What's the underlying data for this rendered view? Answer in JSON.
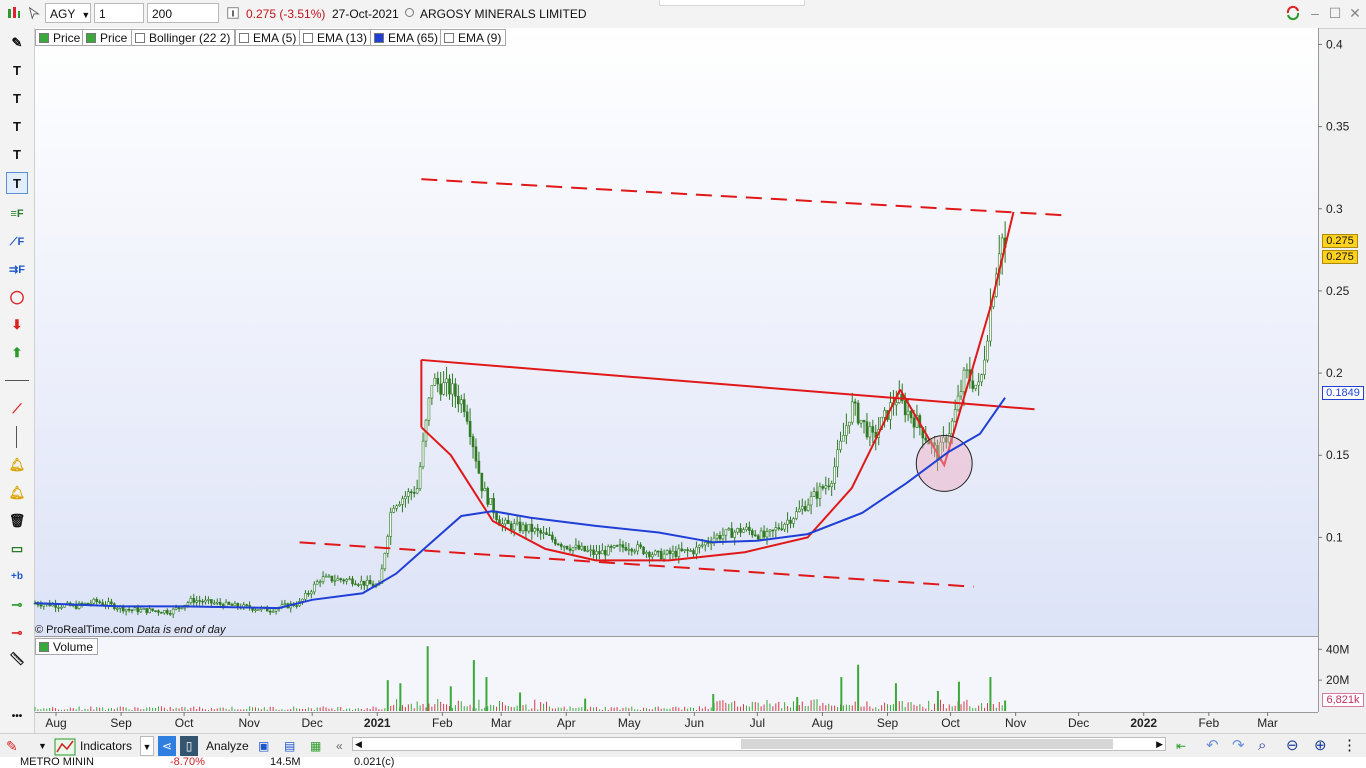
{
  "toolbar": {
    "symbol": "AGY",
    "period": "1 day",
    "units": "200 units",
    "price_change": "0.275 (-3.51%)",
    "date": "27-Oct-2021",
    "instrument": "ARGOSY MINERALS LIMITED"
  },
  "legend": [
    {
      "label": "Price",
      "color": "#3aa83a"
    },
    {
      "label": "Price",
      "color": "#3aa83a"
    },
    {
      "label": "Bollinger (22 2)",
      "color": "#ffffff"
    },
    {
      "label": "EMA (5)",
      "color": "#ffffff"
    },
    {
      "label": "EMA (13)",
      "color": "#ffffff"
    },
    {
      "label": "EMA (65)",
      "color": "#1f3fd6"
    },
    {
      "label": "EMA (9)",
      "color": "#ffffff"
    }
  ],
  "volume_label": "Volume",
  "copyright": "© ProRealTime.com",
  "note": "Data is end of day",
  "price_axis": {
    "ticks": [
      "0.4",
      "0.35",
      "0.3",
      "0.25",
      "0.2",
      "0.15",
      "0.1"
    ]
  },
  "volume_axis": {
    "ticks": [
      "40M",
      "20M"
    ],
    "last_label": "6,821k"
  },
  "price_tags": {
    "close1": "0.275",
    "close2": "0.275",
    "ema65": "0.1849"
  },
  "x_axis": {
    "labels": [
      "Aug",
      "Sep",
      "Oct",
      "Nov",
      "Dec",
      "2021",
      "Feb",
      "Mar",
      "Apr",
      "May",
      "Jun",
      "Jul",
      "Aug",
      "Sep",
      "Oct",
      "Nov",
      "Dec",
      "2022",
      "Feb",
      "Mar"
    ]
  },
  "bottom": {
    "indicators": "Indicators",
    "analyze": "Analyze"
  },
  "ticker": {
    "name": "METRO MININ",
    "change": "-8.70%",
    "volume": "14.5M",
    "price": "0.021(c)"
  },
  "colors": {
    "chart_bg_top": "#ffffff",
    "chart_bg_bottom": "#dde3f7",
    "candle": "#2f7a22",
    "ema": "#1f3fd6",
    "drawing": "#e01818",
    "tag_yellow": "#ffd21f"
  },
  "chart_data": {
    "type": "candlestick",
    "title": "ARGOSY MINERALS LIMITED",
    "ylim": [
      0.04,
      0.41
    ],
    "x_start": "2020-07-22",
    "x_end": "2022-03-25",
    "price_path": [
      [
        "2020-07-22",
        0.06
      ],
      [
        "2020-08-10",
        0.058
      ],
      [
        "2020-08-20",
        0.061
      ],
      [
        "2020-09-05",
        0.056
      ],
      [
        "2020-09-25",
        0.055
      ],
      [
        "2020-10-05",
        0.062
      ],
      [
        "2020-10-20",
        0.059
      ],
      [
        "2020-11-10",
        0.056
      ],
      [
        "2020-11-25",
        0.06
      ],
      [
        "2020-12-05",
        0.075
      ],
      [
        "2020-12-20",
        0.074
      ],
      [
        "2021-01-02",
        0.07
      ],
      [
        "2021-01-08",
        0.12
      ],
      [
        "2021-01-20",
        0.13
      ],
      [
        "2021-01-27",
        0.195
      ],
      [
        "2021-02-05",
        0.19
      ],
      [
        "2021-02-12",
        0.18
      ],
      [
        "2021-02-20",
        0.13
      ],
      [
        "2021-03-01",
        0.108
      ],
      [
        "2021-03-15",
        0.105
      ],
      [
        "2021-04-01",
        0.095
      ],
      [
        "2021-04-15",
        0.09
      ],
      [
        "2021-05-01",
        0.095
      ],
      [
        "2021-05-15",
        0.089
      ],
      [
        "2021-06-01",
        0.092
      ],
      [
        "2021-06-10",
        0.1
      ],
      [
        "2021-06-25",
        0.105
      ],
      [
        "2021-07-05",
        0.1
      ],
      [
        "2021-07-20",
        0.115
      ],
      [
        "2021-08-05",
        0.135
      ],
      [
        "2021-08-15",
        0.18
      ],
      [
        "2021-08-25",
        0.16
      ],
      [
        "2021-09-05",
        0.185
      ],
      [
        "2021-09-15",
        0.17
      ],
      [
        "2021-09-20",
        0.16
      ],
      [
        "2021-09-25",
        0.15
      ],
      [
        "2021-10-02",
        0.17
      ],
      [
        "2021-10-08",
        0.2
      ],
      [
        "2021-10-15",
        0.19
      ],
      [
        "2021-10-20",
        0.24
      ],
      [
        "2021-10-25",
        0.285
      ],
      [
        "2021-10-27",
        0.275
      ]
    ],
    "ema65": [
      [
        "2020-07-22",
        0.06
      ],
      [
        "2020-09-01",
        0.058
      ],
      [
        "2020-10-01",
        0.058
      ],
      [
        "2020-11-15",
        0.057
      ],
      [
        "2020-12-01",
        0.062
      ],
      [
        "2020-12-25",
        0.066
      ],
      [
        "2021-01-10",
        0.078
      ],
      [
        "2021-01-25",
        0.095
      ],
      [
        "2021-02-10",
        0.113
      ],
      [
        "2021-02-25",
        0.116
      ],
      [
        "2021-03-15",
        0.112
      ],
      [
        "2021-04-15",
        0.107
      ],
      [
        "2021-05-15",
        0.103
      ],
      [
        "2021-06-10",
        0.097
      ],
      [
        "2021-07-01",
        0.098
      ],
      [
        "2021-07-25",
        0.102
      ],
      [
        "2021-08-20",
        0.115
      ],
      [
        "2021-09-10",
        0.133
      ],
      [
        "2021-09-30",
        0.152
      ],
      [
        "2021-10-15",
        0.163
      ],
      [
        "2021-10-27",
        0.185
      ]
    ],
    "volume_units": "M",
    "volume_spikes": [
      [
        "2021-01-06",
        20
      ],
      [
        "2021-01-12",
        18
      ],
      [
        "2021-01-25",
        42
      ],
      [
        "2021-02-05",
        16
      ],
      [
        "2021-02-16",
        33
      ],
      [
        "2021-02-22",
        22
      ],
      [
        "2021-03-10",
        12
      ],
      [
        "2021-04-10",
        8
      ],
      [
        "2021-06-10",
        11
      ],
      [
        "2021-07-20",
        9
      ],
      [
        "2021-08-10",
        22
      ],
      [
        "2021-08-18",
        30
      ],
      [
        "2021-09-05",
        18
      ],
      [
        "2021-09-25",
        13
      ],
      [
        "2021-10-05",
        19
      ],
      [
        "2021-10-20",
        22
      ],
      [
        "2021-10-27",
        6.8
      ]
    ],
    "drawings": {
      "upper_channel": {
        "from": [
          "2021-01-22",
          0.318
        ],
        "to": [
          "2021-11-25",
          0.296
        ],
        "style": "dashed"
      },
      "lower_channel": {
        "from": [
          "2020-11-25",
          0.097
        ],
        "to": [
          "2021-10-12",
          0.07
        ],
        "style": "dashed"
      },
      "neckline": {
        "from": [
          "2021-01-22",
          0.208
        ],
        "to": [
          "2021-11-10",
          0.178
        ]
      },
      "cup": [
        [
          "2021-01-22",
          0.167
        ],
        [
          "2021-02-05",
          0.15
        ],
        [
          "2021-02-25",
          0.11
        ],
        [
          "2021-03-22",
          0.093
        ],
        [
          "2021-04-15",
          0.086
        ],
        [
          "2021-05-20",
          0.086
        ],
        [
          "2021-06-25",
          0.091
        ],
        [
          "2021-07-25",
          0.1
        ],
        [
          "2021-08-15",
          0.13
        ],
        [
          "2021-09-07",
          0.19
        ]
      ],
      "handle": [
        [
          "2021-09-07",
          0.19
        ],
        [
          "2021-09-28",
          0.144
        ],
        [
          "2021-10-20",
          0.24
        ],
        [
          "2021-10-31",
          0.298
        ]
      ],
      "highlight_circle": {
        "center": [
          "2021-09-28",
          0.145
        ],
        "radius_days": 14
      }
    }
  }
}
